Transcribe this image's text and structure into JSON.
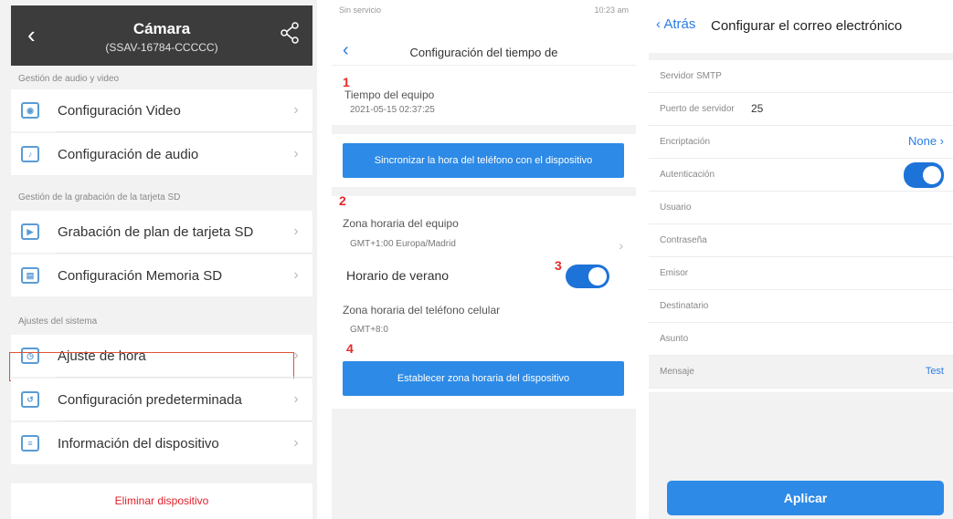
{
  "panel1": {
    "title": "Cámara",
    "subtitle": "(SSAV-16784-CCCCC)",
    "back_icon": "chevron-left-icon",
    "share_icon": "share-icon",
    "sections": [
      {
        "label": "Gestión de audio y video"
      },
      {
        "label": "Gestión de la grabación de la tarjeta SD"
      },
      {
        "label": "Ajustes del sistema"
      }
    ],
    "items": [
      {
        "label": "Configuración Video",
        "icon": "video-settings-icon"
      },
      {
        "label": "Configuración de audio",
        "icon": "audio-settings-icon"
      },
      {
        "label": "Grabación de plan de tarjeta SD",
        "icon": "sd-record-icon"
      },
      {
        "label": "Configuración Memoria SD",
        "icon": "sd-memory-icon"
      },
      {
        "label": "Ajuste de hora",
        "icon": "clock-icon"
      },
      {
        "label": "Configuración predeterminada",
        "icon": "default-settings-icon"
      },
      {
        "label": "Información del dispositivo",
        "icon": "device-info-icon"
      }
    ],
    "chevron": "›",
    "delete_label": "Eliminar dispositivo",
    "highlight_color": "#e0533a"
  },
  "panel2": {
    "status_left": "Sin servicio",
    "status_right": "10:23 am",
    "title": "Configuración del tiempo de",
    "markers": [
      "1",
      "2",
      "3",
      "4"
    ],
    "device_time_label": "Tiempo del equipo",
    "device_time_value": "2021-05-15 02:37:25",
    "sync_button": "Sincronizar la hora del teléfono con el dispositivo",
    "device_zone_label": "Zona horaria del equipo",
    "device_zone_value": "GMT+1:00 Europa/Madrid",
    "dst_label": "Horario de verano",
    "dst_on": true,
    "phone_zone_label": "Zona horaria del teléfono celular",
    "phone_zone_value": "GMT+8:0",
    "set_zone_button": "Establecer zona horaria del dispositivo",
    "accent": "#2d8ae6",
    "marker_color": "#e52a2a"
  },
  "panel3": {
    "back_label": "Atrás",
    "title": "Configurar el correo electrónico",
    "fields": [
      {
        "label": "Servidor SMTP",
        "value": "",
        "right": ""
      },
      {
        "label": "Puerto de servidor",
        "value": "25",
        "right": ""
      },
      {
        "label": "Encriptación",
        "value": "",
        "right": "None ›"
      },
      {
        "label": "Autenticación",
        "value": "",
        "right": ""
      },
      {
        "label": "Usuario",
        "value": "",
        "right": ""
      },
      {
        "label": "Contraseña",
        "value": "",
        "right": ""
      },
      {
        "label": "Emisor",
        "value": "",
        "right": ""
      },
      {
        "label": "Destinatario",
        "value": "",
        "right": ""
      },
      {
        "label": "Asunto",
        "value": "",
        "right": ""
      },
      {
        "label": "Mensaje",
        "value": "",
        "right": "Test"
      }
    ],
    "auth_on": true,
    "apply_label": "Aplicar"
  }
}
